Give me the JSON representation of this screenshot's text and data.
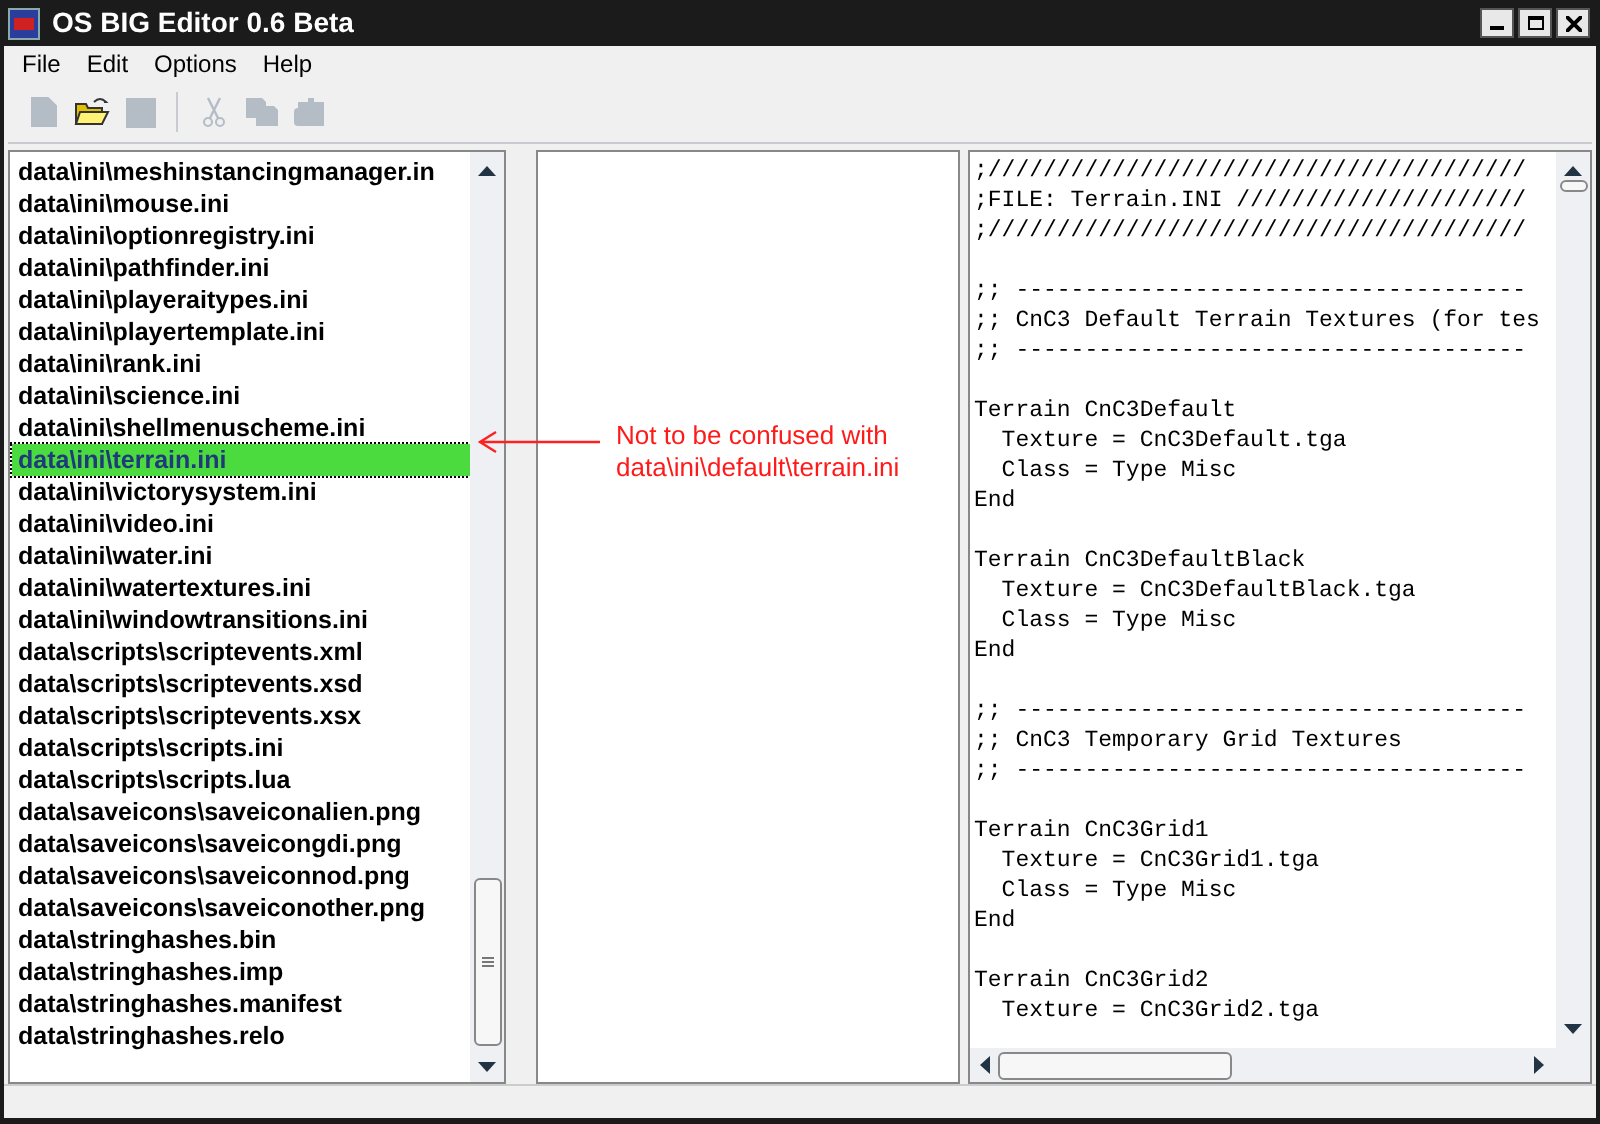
{
  "window": {
    "title": "OS BIG Editor 0.6 Beta"
  },
  "menu": [
    {
      "label": "File"
    },
    {
      "label": "Edit"
    },
    {
      "label": "Options"
    },
    {
      "label": "Help"
    }
  ],
  "toolbar": [
    {
      "kind": "new",
      "disabled": true
    },
    {
      "kind": "open",
      "disabled": false
    },
    {
      "kind": "save",
      "disabled": true
    },
    {
      "kind": "separator"
    },
    {
      "kind": "cut",
      "disabled": true
    },
    {
      "kind": "copy",
      "disabled": true
    },
    {
      "kind": "paste",
      "disabled": true
    }
  ],
  "file_list": {
    "items": [
      {
        "label": "data\\ini\\meshinstancingmanager.in",
        "selected": false
      },
      {
        "label": "data\\ini\\mouse.ini",
        "selected": false
      },
      {
        "label": "data\\ini\\optionregistry.ini",
        "selected": false
      },
      {
        "label": "data\\ini\\pathfinder.ini",
        "selected": false
      },
      {
        "label": "data\\ini\\playeraitypes.ini",
        "selected": false
      },
      {
        "label": "data\\ini\\playertemplate.ini",
        "selected": false
      },
      {
        "label": "data\\ini\\rank.ini",
        "selected": false
      },
      {
        "label": "data\\ini\\science.ini",
        "selected": false
      },
      {
        "label": "data\\ini\\shellmenuscheme.ini",
        "selected": false
      },
      {
        "label": "data\\ini\\terrain.ini",
        "selected": true
      },
      {
        "label": "data\\ini\\victorysystem.ini",
        "selected": false
      },
      {
        "label": "data\\ini\\video.ini",
        "selected": false
      },
      {
        "label": "data\\ini\\water.ini",
        "selected": false
      },
      {
        "label": "data\\ini\\watertextures.ini",
        "selected": false
      },
      {
        "label": "data\\ini\\windowtransitions.ini",
        "selected": false
      },
      {
        "label": "data\\scripts\\scriptevents.xml",
        "selected": false
      },
      {
        "label": "data\\scripts\\scriptevents.xsd",
        "selected": false
      },
      {
        "label": "data\\scripts\\scriptevents.xsx",
        "selected": false
      },
      {
        "label": "data\\scripts\\scripts.ini",
        "selected": false
      },
      {
        "label": "data\\scripts\\scripts.lua",
        "selected": false
      },
      {
        "label": "data\\saveicons\\saveiconalien.png",
        "selected": false
      },
      {
        "label": "data\\saveicons\\saveicongdi.png",
        "selected": false
      },
      {
        "label": "data\\saveicons\\saveiconnod.png",
        "selected": false
      },
      {
        "label": "data\\saveicons\\saveiconother.png",
        "selected": false
      },
      {
        "label": "data\\stringhashes.bin",
        "selected": false
      },
      {
        "label": "data\\stringhashes.imp",
        "selected": false
      },
      {
        "label": "data\\stringhashes.manifest",
        "selected": false
      },
      {
        "label": "data\\stringhashes.relo",
        "selected": false
      }
    ]
  },
  "annotation": {
    "lines": [
      "Not to be confused with",
      "data\\ini\\default\\terrain.ini"
    ]
  },
  "editor": {
    "blocks": [
      [
        ";///////////////////////////////////////",
        ";FILE: Terrain.INI /////////////////////",
        ";///////////////////////////////////////"
      ],
      [
        ";; -------------------------------------",
        ";; CnC3 Default Terrain Textures (for tes",
        ";; -------------------------------------"
      ],
      [
        "Terrain CnC3Default",
        "  Texture = CnC3Default.tga",
        "  Class = Type Misc",
        "End"
      ],
      [
        "Terrain CnC3DefaultBlack",
        "  Texture = CnC3DefaultBlack.tga",
        "  Class = Type Misc",
        "End"
      ],
      [
        ";; -------------------------------------",
        ";; CnC3 Temporary Grid Textures",
        ";; -------------------------------------"
      ],
      [
        "Terrain CnC3Grid1",
        "  Texture = CnC3Grid1.tga",
        "  Class = Type Misc",
        "End"
      ],
      [
        "Terrain CnC3Grid2",
        "  Texture = CnC3Grid2.tga"
      ]
    ]
  }
}
